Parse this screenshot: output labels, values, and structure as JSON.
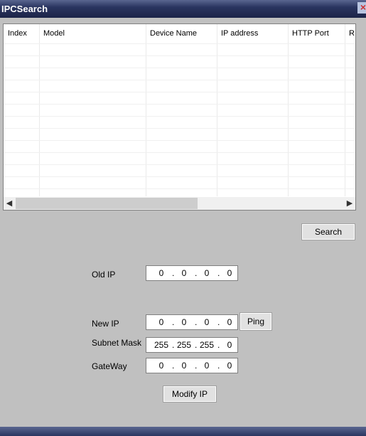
{
  "window": {
    "title": "IPCSearch",
    "close_icon": "close-icon"
  },
  "table": {
    "columns": [
      "Index",
      "Model",
      "Device Name",
      "IP address",
      "HTTP Port",
      "R"
    ],
    "rows": []
  },
  "buttons": {
    "search": "Search",
    "ping": "Ping",
    "modify": "Modify IP"
  },
  "form": {
    "old_ip": {
      "label": "Old IP",
      "value": [
        "0",
        "0",
        "0",
        "0"
      ]
    },
    "new_ip": {
      "label": "New IP",
      "value": [
        "0",
        "0",
        "0",
        "0"
      ]
    },
    "subnet": {
      "label": "Subnet Mask",
      "value": [
        "255",
        "255",
        "255",
        "0"
      ]
    },
    "gateway": {
      "label": "GateWay",
      "value": [
        "0",
        "0",
        "0",
        "0"
      ]
    }
  }
}
